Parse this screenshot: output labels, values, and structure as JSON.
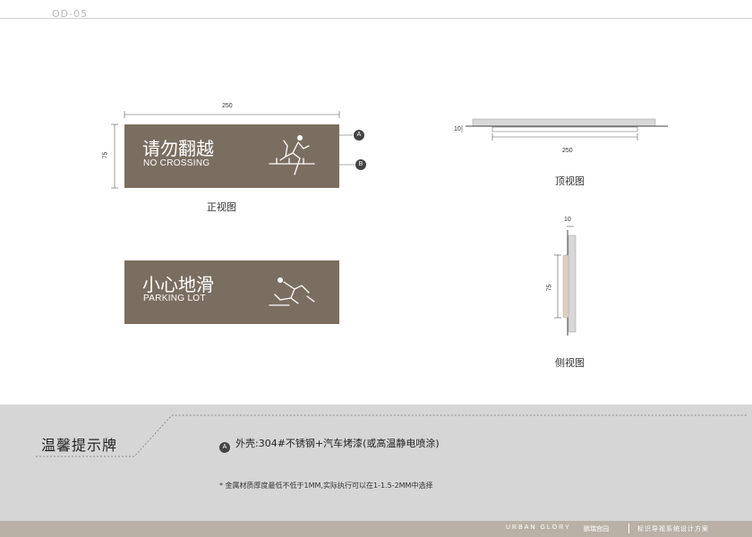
{
  "page_code": "OD-05",
  "front": {
    "width_dim": "250",
    "height_dim": "75",
    "title_cn": "请勿翻越",
    "title_en": "NO CROSSING",
    "callout_a": "A",
    "callout_b": "B",
    "caption": "正视图"
  },
  "variant": {
    "title_cn": "小心地滑",
    "title_en": "PARKING LOT"
  },
  "top_view": {
    "thickness_dim": "10",
    "width_dim": "250",
    "caption": "顶视图"
  },
  "side_view": {
    "thickness_dim": "10",
    "height_dim": "75",
    "caption": "侧视图"
  },
  "section": {
    "title": "温馨提示牌",
    "material_marker": "A",
    "material_text": "外壳:304#不锈钢+汽车烤漆(或高温静电喷涂)",
    "note": "* 金属材质厚度最低不低于1MM,实际执行可以在1-1.5-2MM中选择"
  },
  "footer": {
    "brand": "URBAN GLORY",
    "logo": "鹏瑞宫园",
    "project": "标识导视系统设计方案"
  },
  "colors": {
    "sign_fill": "#7a6e60",
    "band": "#d6d6d6",
    "footer": "#b9b1a6"
  }
}
